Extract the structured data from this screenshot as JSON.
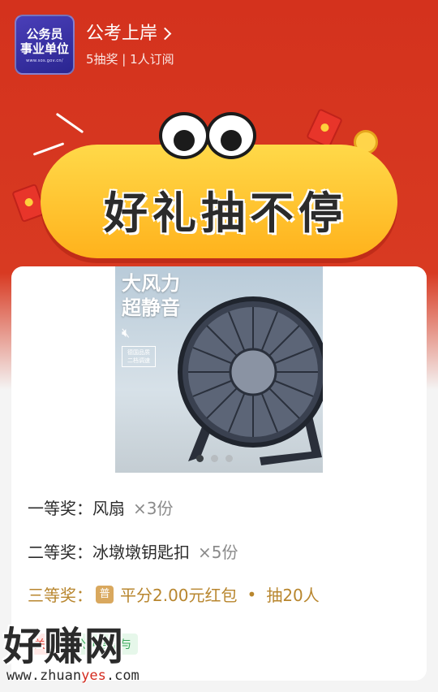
{
  "header": {
    "logo_line1": "公务员",
    "logo_line2": "事业单位",
    "logo_url_text": "www.sos.gov.cn/",
    "account_name": "公考上岸",
    "account_sub": "5抽奖 | 1人订阅"
  },
  "banner": {
    "slogan": "好礼抽不停"
  },
  "product": {
    "headline_1": "大风力",
    "headline_2": "超静音",
    "feature_tag_1": "德国品质",
    "feature_tag_2": "二档调速",
    "carousel": {
      "count": 3,
      "active_index": 0
    }
  },
  "prizes": [
    {
      "label": "一等奖：",
      "name": "风扇",
      "qty": "×3份"
    },
    {
      "label": "二等奖：",
      "name": "冰墩墩钥匙扣",
      "qty": "×5份"
    },
    {
      "label": "三等奖：",
      "badge": "普",
      "name": "平分2.00元红包",
      "dot": "•",
      "qty": "抽20人"
    }
  ],
  "chips": {
    "tag1": "关注",
    "tag2": "公众号参与"
  },
  "watermark": {
    "title": "好赚网",
    "url_prefix": "www.zhuan",
    "url_yes": "yes",
    "url_suffix": ".com"
  },
  "colors": {
    "header_red": "#d4321d",
    "pill_yellow": "#ffc72e",
    "prize_gold": "#b8862e",
    "badge_gold": "#d9a85e"
  }
}
